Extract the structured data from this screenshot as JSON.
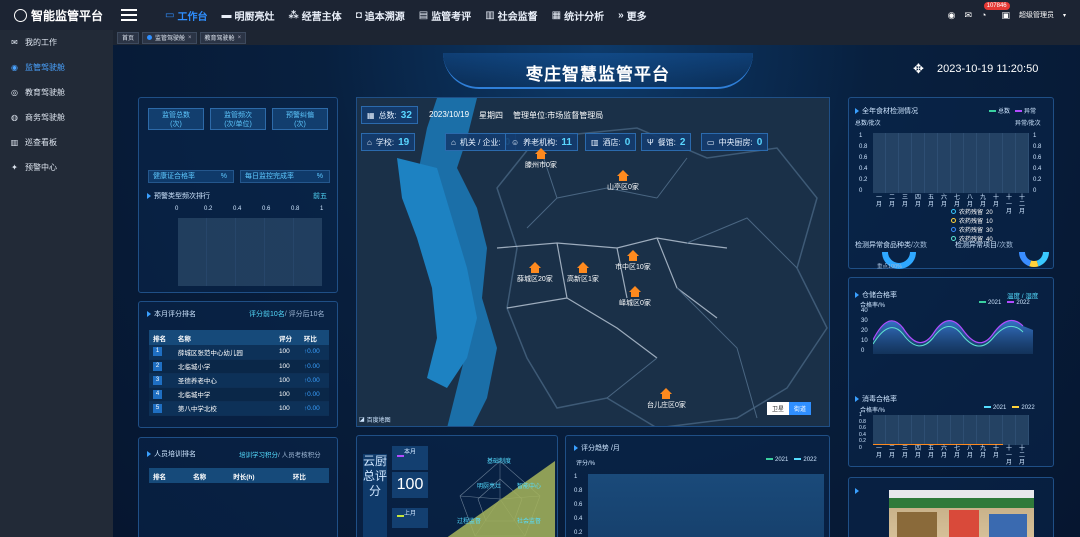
{
  "app": {
    "title": "智能监管平台"
  },
  "nav": [
    {
      "label": "工作台",
      "icon": "monitor-icon",
      "glyph": "▭",
      "active": true
    },
    {
      "label": "明厨亮灶",
      "icon": "car-icon",
      "glyph": "▬",
      "active": false
    },
    {
      "label": "经营主体",
      "icon": "sitemap-icon",
      "glyph": "⁂",
      "active": false
    },
    {
      "label": "追本溯源",
      "icon": "camera-icon",
      "glyph": "◘",
      "active": false
    },
    {
      "label": "监管考评",
      "icon": "id-card-icon",
      "glyph": "▤",
      "active": false
    },
    {
      "label": "社会监督",
      "icon": "map-icon",
      "glyph": "▥",
      "active": false
    },
    {
      "label": "统计分析",
      "icon": "bar-chart-icon",
      "glyph": "▦",
      "active": false
    },
    {
      "label": "更多",
      "icon": "more-icon",
      "glyph": "»",
      "active": false
    }
  ],
  "topright": {
    "badge": "107846",
    "user": "超级管理员"
  },
  "sidebar": [
    {
      "label": "我的工作",
      "icon": "mail-icon",
      "glyph": "✉",
      "active": false
    },
    {
      "label": "监管驾驶舱",
      "icon": "dashboard-icon",
      "glyph": "◉",
      "active": true
    },
    {
      "label": "教育驾驶舱",
      "icon": "compass-icon",
      "glyph": "◎",
      "active": false
    },
    {
      "label": "商务驾驶舱",
      "icon": "gauge-icon",
      "glyph": "◍",
      "active": false
    },
    {
      "label": "巡查看板",
      "icon": "book-icon",
      "glyph": "▥",
      "active": false
    },
    {
      "label": "预警中心",
      "icon": "alert-icon",
      "glyph": "✦",
      "active": false
    }
  ],
  "tabs": [
    {
      "label": "首页",
      "closable": false,
      "dot": false
    },
    {
      "label": "监管驾驶舱",
      "closable": true,
      "dot": true
    },
    {
      "label": "教育驾驶舱",
      "closable": true,
      "dot": false
    }
  ],
  "dashboard": {
    "title": "枣庄智慧监管平台",
    "datetime": "2023-10-19 11:20:50",
    "stats": [
      {
        "label": "监管总数",
        "unit": "(次)"
      },
      {
        "label": "监管频次",
        "unit": "(次/单位)"
      },
      {
        "label": "预警纠偏",
        "unit": "(次)"
      }
    ],
    "rates": [
      {
        "label": "健康证合格率",
        "unit": "%"
      },
      {
        "label": "每日监控完成率",
        "unit": "%"
      }
    ],
    "warning_rank": {
      "title": "预警类型频次排行",
      "tag": "前五",
      "ticks": [
        "0",
        "0.2",
        "0.4",
        "0.6",
        "0.8",
        "1"
      ]
    },
    "score_rank": {
      "title": "本月评分排名",
      "tag_a": "评分前10名",
      "tag_b": "/ 评分后10名",
      "headers": [
        "排名",
        "名称",
        "评分",
        "环比"
      ],
      "rows": [
        {
          "rank": "1",
          "name": "薛城区张范中心幼儿园",
          "score": "100",
          "mom": "↑0.00"
        },
        {
          "rank": "2",
          "name": "北临城小学",
          "score": "100",
          "mom": "↑0.00"
        },
        {
          "rank": "3",
          "name": "圣德养老中心",
          "score": "100",
          "mom": "↑0.00"
        },
        {
          "rank": "4",
          "name": "北临城中学",
          "score": "100",
          "mom": "↑0.00"
        },
        {
          "rank": "5",
          "name": "第八中学北校",
          "score": "100",
          "mom": "↑0.00"
        }
      ]
    },
    "training_rank": {
      "title": "人员培训排名",
      "tag_a": "培训学习积分",
      "tag_b": "/ 人员考核积分",
      "headers": [
        "排名",
        "名称",
        "时长(h)",
        "环比"
      ]
    },
    "map": {
      "total_label": "总数:",
      "total": "32",
      "date": "2023/10/19",
      "weekday": "星期四",
      "unit_label": "管理单位:",
      "unit": "市场监督管理局",
      "chips": [
        {
          "label": "学校:",
          "value": "19",
          "icon": "school-icon"
        },
        {
          "label": "机关 / 企业:",
          "value": "0",
          "icon": "home-icon"
        },
        {
          "label": "养老机构:",
          "value": "11",
          "icon": "elder-icon"
        },
        {
          "label": "酒店:",
          "value": "0",
          "icon": "hotel-icon"
        },
        {
          "label": "餐馆:",
          "value": "2",
          "icon": "fork-icon"
        },
        {
          "label": "中央厨房:",
          "value": "0",
          "icon": "kitchen-icon"
        }
      ],
      "markers": [
        {
          "label": "滕州市0家"
        },
        {
          "label": "山亭区0家"
        },
        {
          "label": "薛城区20家"
        },
        {
          "label": "高新区1家"
        },
        {
          "label": "市中区10家"
        },
        {
          "label": "峄城区0家"
        },
        {
          "label": "台儿庄区0家"
        }
      ],
      "sat": "卫星",
      "std": "街道",
      "corner": "百度地图"
    },
    "cloud": {
      "vertical": "云厨总评分",
      "this_month": "本月",
      "last_month": "上月",
      "value": "100",
      "radar_labels": [
        "基础制度",
        "明厨亮灶",
        "智能中心",
        "过程监督",
        "社会监督"
      ]
    },
    "trend": {
      "title": "评分趋势 /月",
      "ylabel": "评分/%",
      "legend": [
        "2021",
        "2022"
      ],
      "yticks": [
        "1",
        "0.8",
        "0.6",
        "0.4",
        "0.2"
      ]
    },
    "food_test": {
      "title": "全年食材检测情况",
      "legend": [
        "总数",
        "异常"
      ],
      "yleft": "总数/批次",
      "yright": "异常/批次",
      "yticks": [
        "1",
        "0.8",
        "0.6",
        "0.4",
        "0.2",
        "0"
      ],
      "months": [
        "一月",
        "二月",
        "三月",
        "四月",
        "五月",
        "六月",
        "七月",
        "八月",
        "九月",
        "十月",
        "十一月",
        "十二月"
      ],
      "abnormal_title": "检测异常食品种类",
      "abnormal_unit": "/次数",
      "project_title": "检测异常项目",
      "project_unit": "/次数",
      "donut_label": "重点100%",
      "items": [
        {
          "name": "农药残留",
          "value": "20",
          "color": "#39c9ff"
        },
        {
          "name": "农药残留",
          "value": "10",
          "color": "#ffd23a"
        },
        {
          "name": "农药残留",
          "value": "30",
          "color": "#3a8dff"
        },
        {
          "name": "农药残留",
          "value": "40",
          "color": "#5ee2d0"
        }
      ]
    },
    "storage": {
      "title": "仓储合格率",
      "tag": "温度 / 湿度",
      "ylabel": "合格率/%",
      "legend": [
        "2021",
        "2022"
      ],
      "yticks": [
        "40",
        "30",
        "20",
        "10",
        "0"
      ]
    },
    "disinfect": {
      "title": "消毒合格率",
      "ylabel": "合格率/%",
      "legend": [
        "2021",
        "2022"
      ],
      "yticks": [
        "1",
        "0.8",
        "0.6",
        "0.4",
        "0.2",
        "0"
      ]
    },
    "colors": {
      "accent": "#2f8fff",
      "cyan": "#55ddff",
      "orange": "#ff8a1e",
      "purple": "#b24bff"
    }
  }
}
